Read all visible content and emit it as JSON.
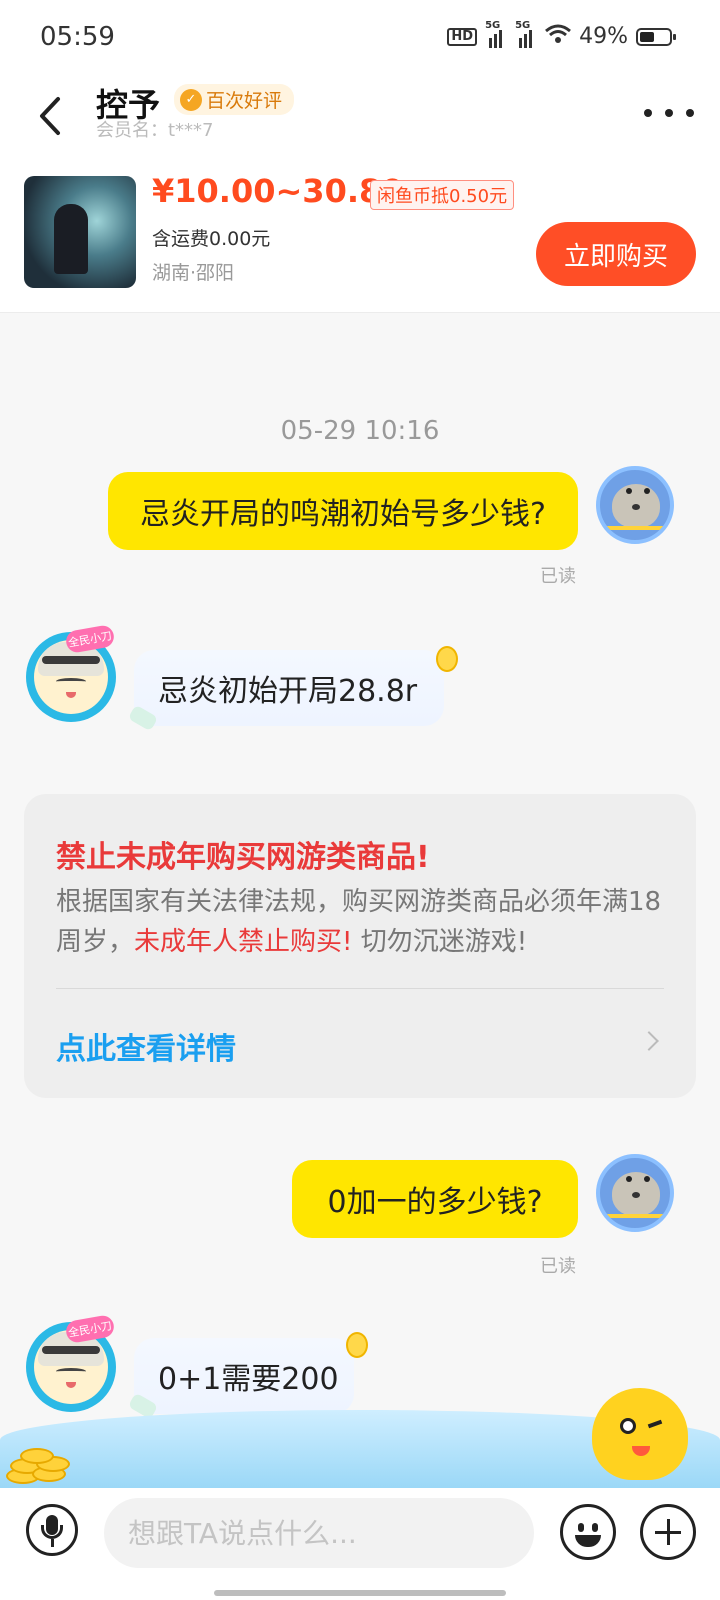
{
  "status_bar": {
    "time": "05:59",
    "hd_label": "HD",
    "signal1": "5G",
    "signal2": "5G",
    "battery_text": "49%",
    "battery_level": 0.49
  },
  "header": {
    "seller_name": "控予",
    "badge": "百次好评",
    "member_label": "会员名：t***7"
  },
  "product": {
    "price": "¥10.00~30.80",
    "coin_deduction": "闲鱼币抵0.50元",
    "shipping": "含运费0.00元",
    "location": "湖南·邵阳",
    "buy_button": "立即购买"
  },
  "chat": {
    "timestamp": "05-29 10:16",
    "messages": [
      {
        "from": "me",
        "text": "忌炎开局的鸣潮初始号多少钱?",
        "status": "已读"
      },
      {
        "from": "seller",
        "text": "忌炎初始开局28.8r",
        "avatar_tag": "全民小刀"
      },
      {
        "from": "me",
        "text": "0加一的多少钱?",
        "status": "已读"
      },
      {
        "from": "seller",
        "text": "0+1需要200",
        "avatar_tag": "全民小刀"
      }
    ],
    "notice": {
      "title": "禁止未成年购买网游类商品!",
      "body_pre": "根据国家有关法律法规，购买网游类商品必须年满18周岁，",
      "body_highlight": "未成年人禁止购买!",
      "body_post": " 切勿沉迷游戏!",
      "link": "点此查看详情"
    }
  },
  "input_bar": {
    "placeholder": "想跟TA说点什么..."
  },
  "colors": {
    "accent_yellow": "#ffe600",
    "buy_orange": "#ff4e26",
    "warning_red": "#e93a3a",
    "link_blue": "#1a9ff0"
  },
  "icons": [
    "back-icon",
    "more-icon",
    "mic-icon",
    "emoji-icon",
    "plus-icon",
    "chevron-right-icon"
  ]
}
